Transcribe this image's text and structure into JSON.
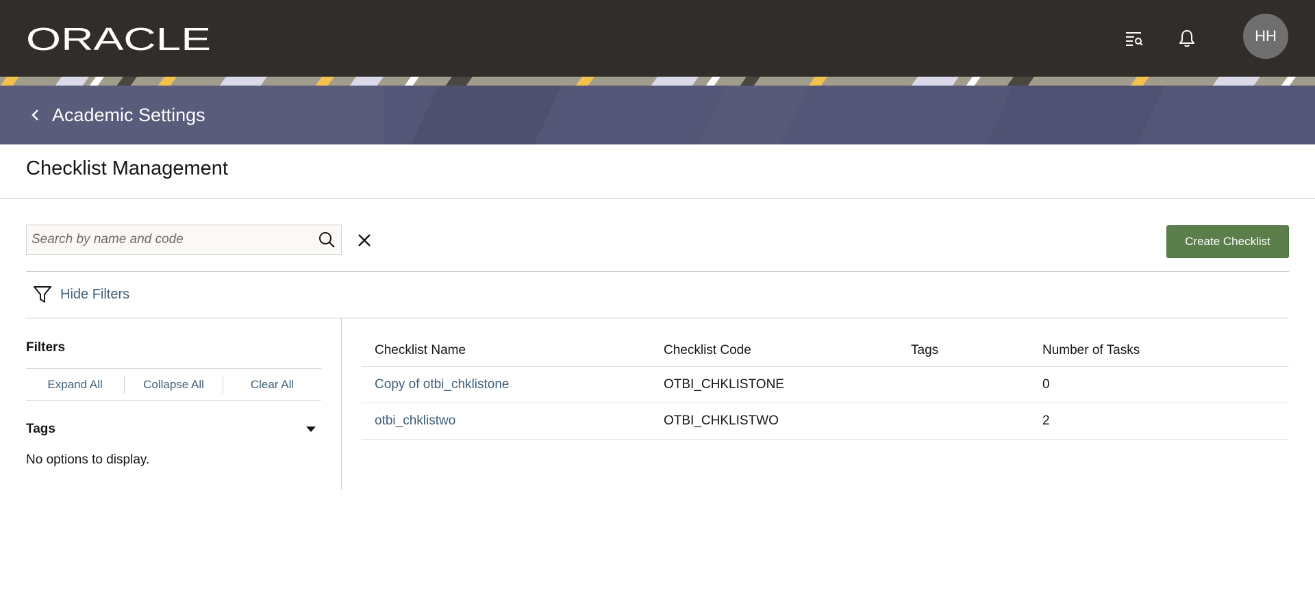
{
  "header": {
    "logo_text": "ORACLE",
    "avatar_initials": "HH",
    "icons": [
      "search-list-icon",
      "bell-icon"
    ]
  },
  "banner": {
    "back_label": "Academic Settings"
  },
  "page": {
    "title": "Checklist Management"
  },
  "search": {
    "placeholder": "Search by name and code",
    "value": ""
  },
  "toolbar": {
    "create_label": "Create Checklist",
    "hide_filters_label": "Hide Filters"
  },
  "filters": {
    "heading": "Filters",
    "actions": [
      "Expand All",
      "Collapse All",
      "Clear All"
    ],
    "tags_label": "Tags",
    "tags_empty": "No options to display."
  },
  "table": {
    "columns": [
      "Checklist Name",
      "Checklist Code",
      "Tags",
      "Number of Tasks"
    ],
    "rows": [
      {
        "name": "Copy of otbi_chklistone",
        "code": "OTBI_CHKLISTONE",
        "tags": "",
        "tasks": "0"
      },
      {
        "name": "otbi_chklistwo",
        "code": "OTBI_CHKLISTWO",
        "tags": "",
        "tasks": "2"
      }
    ]
  },
  "colors": {
    "topbar": "#312d2a",
    "banner": "#545677",
    "primary_button": "#5b7e4b",
    "link": "#3e5f7a"
  }
}
